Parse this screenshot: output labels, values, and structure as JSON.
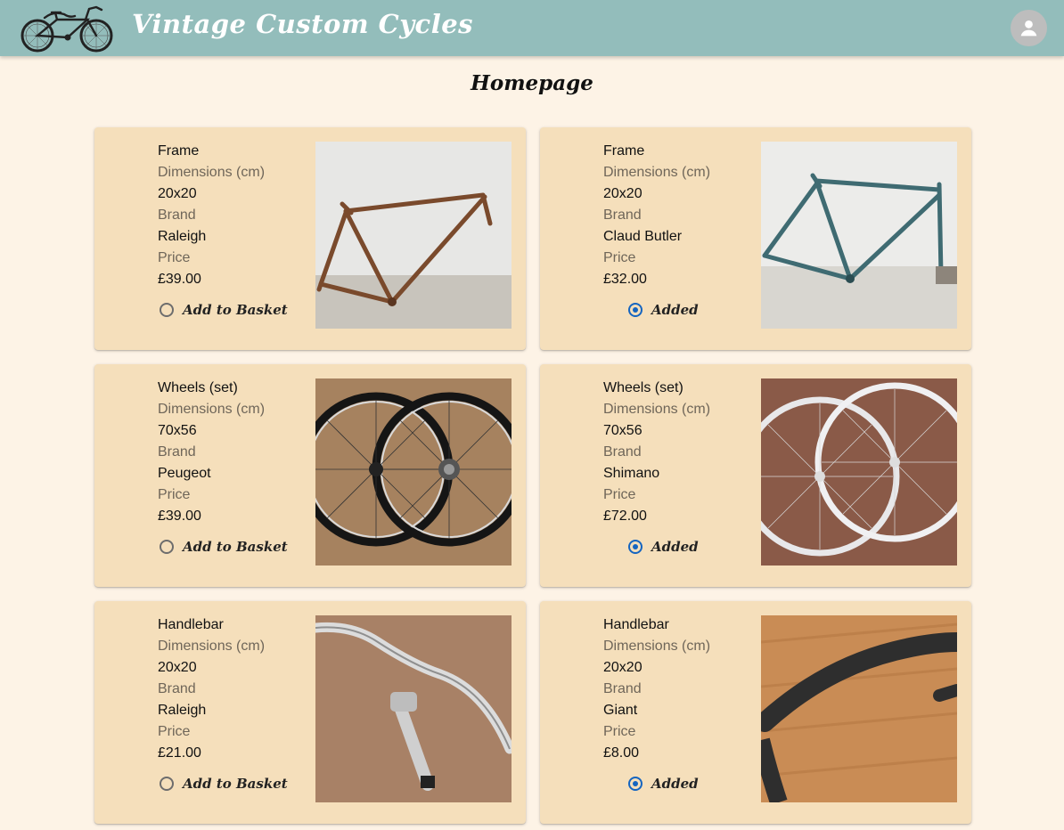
{
  "header": {
    "app_title": "Vintage Custom Cycles",
    "logo_icon": "vintage-bicycle-logo",
    "account_icon": "account-circle-icon",
    "background_color": "#93bdbb"
  },
  "page": {
    "title": "Homepage",
    "background_color": "#fdf3e6"
  },
  "labels": {
    "dimensions": "Dimensions (cm)",
    "brand": "Brand",
    "price": "Price",
    "add_to_basket": "Add to Basket",
    "added": "Added"
  },
  "products": [
    {
      "name": "Frame",
      "dimensions": "20x20",
      "brand": "Raleigh",
      "price": "£39.00",
      "in_basket": false,
      "image": "rusty-brown-bicycle-frame"
    },
    {
      "name": "Frame",
      "dimensions": "20x20",
      "brand": "Claud Butler",
      "price": "£32.00",
      "in_basket": true,
      "image": "teal-bicycle-frame"
    },
    {
      "name": "Wheels (set)",
      "dimensions": "70x56",
      "brand": "Peugeot",
      "price": "£39.00",
      "in_basket": false,
      "image": "black-wheel-set"
    },
    {
      "name": "Wheels (set)",
      "dimensions": "70x56",
      "brand": "Shimano",
      "price": "£72.00",
      "in_basket": true,
      "image": "silver-wheel-set"
    },
    {
      "name": "Handlebar",
      "dimensions": "20x20",
      "brand": "Raleigh",
      "price": "£21.00",
      "in_basket": false,
      "image": "chrome-handlebar-with-stem"
    },
    {
      "name": "Handlebar",
      "dimensions": "20x20",
      "brand": "Giant",
      "price": "£8.00",
      "in_basket": true,
      "image": "black-drop-handlebar-on-wood"
    }
  ],
  "colors": {
    "card": "#f5dfbb",
    "radio_selected": "#1565c0"
  }
}
